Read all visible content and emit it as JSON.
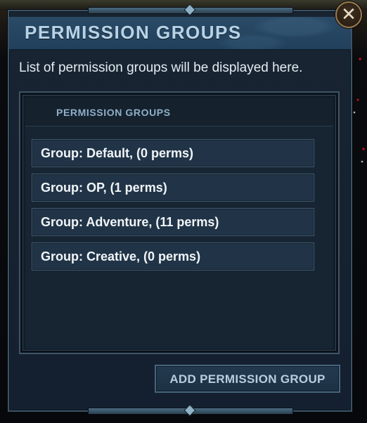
{
  "dialog": {
    "title": "PERMISSION GROUPS",
    "close_icon": "✕",
    "description": "List of permission groups will be displayed here."
  },
  "list": {
    "header": "PERMISSION GROUPS",
    "groups": [
      {
        "label": "Group: Default, (0 perms)"
      },
      {
        "label": "Group: OP, (1 perms)"
      },
      {
        "label": "Group: Adventure, (11 perms)"
      },
      {
        "label": "Group: Creative, (0 perms)"
      }
    ]
  },
  "actions": {
    "add_label": "ADD PERMISSION GROUP"
  },
  "colors": {
    "title_text": "#b9d3e6",
    "panel": "#182431",
    "accent_border": "#3c5366",
    "close_ring": "#9c7d52"
  }
}
